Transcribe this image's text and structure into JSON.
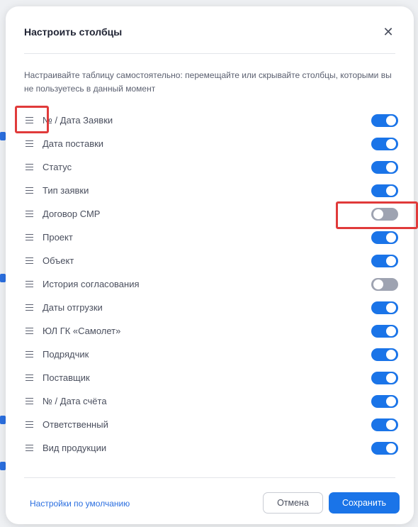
{
  "dialog": {
    "title": "Настроить столбцы",
    "close_glyph": "✕",
    "description": "Настраивайте таблицу самостоятельно: перемещайте или скрывайте столбцы, которыми вы не пользуетесь в данный момент"
  },
  "columns": [
    {
      "label": "№ / Дата Заявки",
      "enabled": true
    },
    {
      "label": "Дата поставки",
      "enabled": true
    },
    {
      "label": "Статус",
      "enabled": true
    },
    {
      "label": "Тип заявки",
      "enabled": true
    },
    {
      "label": "Договор СМР",
      "enabled": false
    },
    {
      "label": "Проект",
      "enabled": true
    },
    {
      "label": "Объект",
      "enabled": true
    },
    {
      "label": "История согласования",
      "enabled": false
    },
    {
      "label": "Даты отгрузки",
      "enabled": true
    },
    {
      "label": "ЮЛ ГК «Самолет»",
      "enabled": true
    },
    {
      "label": "Подрядчик",
      "enabled": true
    },
    {
      "label": "Поставщик",
      "enabled": true
    },
    {
      "label": "№ / Дата счёта",
      "enabled": true
    },
    {
      "label": "Ответственный",
      "enabled": true
    },
    {
      "label": "Вид продукции",
      "enabled": true
    }
  ],
  "footer": {
    "reset_link": "Настройки по умолчанию",
    "cancel_label": "Отмена",
    "save_label": "Сохранить"
  },
  "colors": {
    "accent": "#1a74e8",
    "toggle_off": "#9ea3b1",
    "highlight": "#e03a3a"
  }
}
